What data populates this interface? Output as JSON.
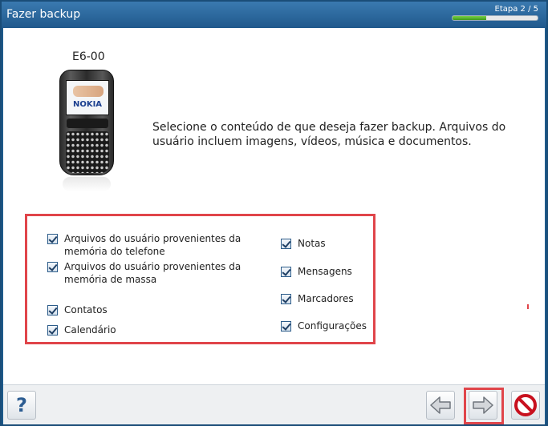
{
  "window": {
    "title": "Fazer backup",
    "step_label": "Etapa 2 / 5",
    "progress": 0.4
  },
  "device": {
    "name": "E6-00",
    "brand": "NOKIA"
  },
  "instruction": "Selecione o conteúdo de que deseja fazer backup. Arquivos do usuário incluem imagens, vídeos, música e documentos.",
  "options": {
    "left": [
      {
        "label": "Arquivos do usuário provenientes da memória do telefone",
        "checked": true
      },
      {
        "label": "Arquivos do usuário provenientes da memória de massa",
        "checked": true
      },
      {
        "label": "Contatos",
        "checked": true
      },
      {
        "label": "Calendário",
        "checked": true
      }
    ],
    "right": [
      {
        "label": "Notas",
        "checked": true
      },
      {
        "label": "Mensagens",
        "checked": true
      },
      {
        "label": "Marcadores",
        "checked": true
      },
      {
        "label": "Configurações",
        "checked": true
      }
    ]
  },
  "buttons": {
    "help_icon": "question-mark-icon",
    "help_glyph": "?",
    "back_icon": "arrow-left-icon",
    "next_icon": "arrow-right-icon",
    "cancel_icon": "cancel-icon"
  },
  "colors": {
    "titlebar": "#20598c",
    "highlight": "#e0454a",
    "progress": "#4aa82a"
  }
}
